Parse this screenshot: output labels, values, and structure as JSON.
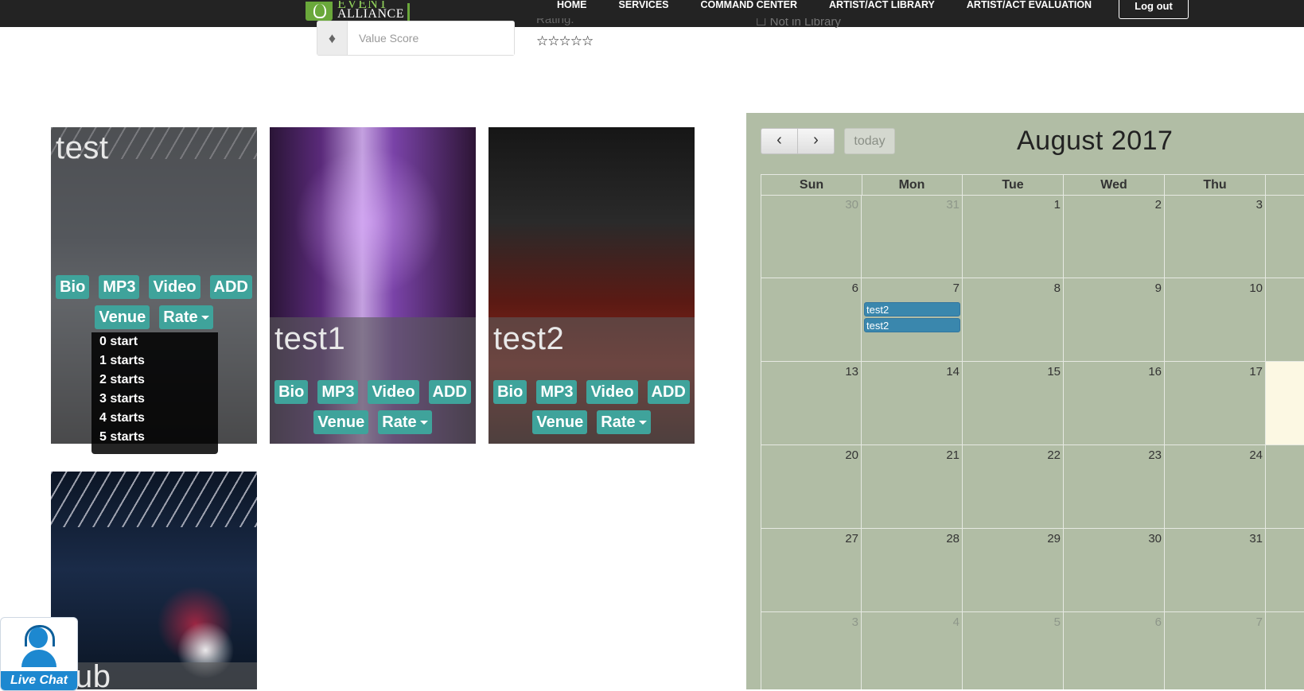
{
  "nav": {
    "logo_top": "EVENT",
    "logo_bottom": "ALLIANCE",
    "links": [
      "HOME",
      "SERVICES",
      "COMMAND CENTER",
      "ARTIST/ACT LIBRARY",
      "ARTIST/ACT EVALUATION"
    ],
    "logout": "Log out"
  },
  "filters": {
    "value_score_placeholder": "Value Score",
    "rating_label": "Rating:",
    "stars": "☆☆☆☆☆",
    "library_label": "☐ Not in Library"
  },
  "tiles": [
    {
      "name": "test"
    },
    {
      "name": "test1"
    },
    {
      "name": "test2"
    },
    {
      "name": "ub"
    }
  ],
  "tile_buttons": {
    "bio": "Bio",
    "mp3": "MP3",
    "video": "Video",
    "add": "ADD",
    "venue": "Venue",
    "rate": "Rate"
  },
  "rate_dropdown": [
    "0 start",
    "1 starts",
    "2 starts",
    "3 starts",
    "4 starts",
    "5 starts"
  ],
  "calendar": {
    "prev_icon": "‹",
    "next_icon": "›",
    "today": "today",
    "title": "August 2017",
    "weekdays": [
      "Sun",
      "Mon",
      "Tue",
      "Wed",
      "Thu"
    ],
    "weeks": [
      [
        "30",
        "31",
        "1",
        "2",
        "3"
      ],
      [
        "6",
        "7",
        "8",
        "9",
        "10"
      ],
      [
        "13",
        "14",
        "15",
        "16",
        "17"
      ],
      [
        "20",
        "21",
        "22",
        "23",
        "24"
      ],
      [
        "27",
        "28",
        "29",
        "30",
        "31"
      ],
      [
        "3",
        "4",
        "5",
        "6",
        "7"
      ]
    ],
    "other_month": [
      [
        0,
        0
      ],
      [
        0,
        1
      ],
      [
        5,
        0
      ],
      [
        5,
        1
      ],
      [
        5,
        2
      ],
      [
        5,
        3
      ],
      [
        5,
        4
      ]
    ],
    "events": [
      {
        "week": 1,
        "day": 1,
        "labels": [
          "test2",
          "test2"
        ]
      }
    ],
    "colors": {
      "background": "#b1bda5",
      "event": "#3a87ad",
      "today_highlight": "#fcf8e3"
    }
  },
  "live_chat": {
    "label": "Live Chat"
  },
  "colors": {
    "nav": "#232323",
    "button": "#3fa39b",
    "logo_green": "#6aa83b"
  }
}
